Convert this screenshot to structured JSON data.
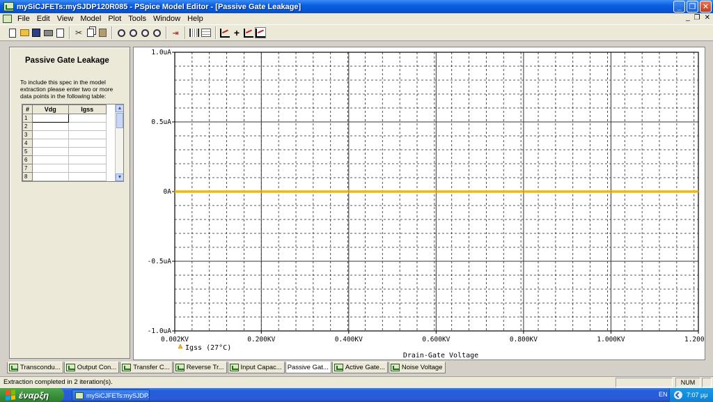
{
  "window": {
    "title": "mySiCJFETs:mySJDP120R085 - PSpice Model Editor - [Passive Gate Leakage]"
  },
  "menu": {
    "items": [
      "File",
      "Edit",
      "View",
      "Model",
      "Plot",
      "Tools",
      "Window",
      "Help"
    ]
  },
  "toolbar": {
    "icons": [
      "new-icon",
      "open-icon",
      "save-icon",
      "print-icon",
      "print-preview-icon",
      "cut-icon",
      "copy-icon",
      "paste-icon",
      "zoom-in-icon",
      "zoom-out-icon",
      "zoom-area-icon",
      "zoom-fit-icon",
      "fit-arrow-icon",
      "bars-icon",
      "grid-icon",
      "add-trace-icon",
      "cursor-icon",
      "log-x-icon",
      "log-y-icon"
    ]
  },
  "spec_panel": {
    "title": "Passive Gate Leakage",
    "description": "To include this spec in the model extraction please enter two or more data points in the following table:",
    "table": {
      "headers": [
        "#",
        "Vdg",
        "Igss"
      ],
      "rows": [
        "1",
        "2",
        "3",
        "4",
        "5",
        "6",
        "7",
        "8"
      ]
    }
  },
  "chart_data": {
    "type": "line",
    "xlabel": "Drain-Gate Voltage",
    "xlim": [
      0.002,
      1.2
    ],
    "ylim": [
      -1.0,
      1.0
    ],
    "x_ticks": [
      "0.002KV",
      "0.200KV",
      "0.400KV",
      "0.600KV",
      "0.800KV",
      "1.000KV",
      "1.200KV"
    ],
    "y_ticks": [
      "1.0uA",
      "0.5uA",
      "0A",
      "-0.5uA",
      "-1.0uA"
    ],
    "grid": true,
    "legend_position": "bottom-left",
    "series": [
      {
        "name": "Igss (27°C)",
        "color": "#f5b800",
        "x": [
          0.002,
          0.2,
          0.4,
          0.6,
          0.8,
          1.0,
          1.2
        ],
        "y": [
          0,
          0,
          0,
          0,
          0,
          0,
          0
        ]
      }
    ]
  },
  "plot_tabs": [
    {
      "label": "Transcondu...",
      "active": false
    },
    {
      "label": "Output Con...",
      "active": false
    },
    {
      "label": "Transfer C...",
      "active": false
    },
    {
      "label": "Reverse Tr...",
      "active": false
    },
    {
      "label": "Input Capac...",
      "active": false
    },
    {
      "label": "Passive Gat...",
      "active": true
    },
    {
      "label": "Active Gate...",
      "active": false
    },
    {
      "label": "Noise Voltage",
      "active": false
    }
  ],
  "statusbar": {
    "message": "Extraction completed in 2 iteration(s).",
    "num_indicator": "NUM"
  },
  "taskbar": {
    "start_label": "έναρξη",
    "task_label": "mySiCJFETs:mySJDP...",
    "language": "EN",
    "clock": "7:07 μμ"
  }
}
